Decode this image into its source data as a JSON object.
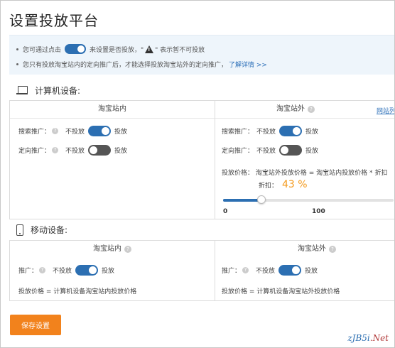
{
  "page": {
    "title": "设置投放平台"
  },
  "notice": {
    "line1_prefix": "您可通过点击",
    "line1_middle": "来设置是否投放，\"",
    "line1_suffix": "\" 表示暂不可投放",
    "line2_text": "您只有投放淘宝站内的定向推广后，才能选择投放淘宝站外的定向推广，",
    "line2_link": "了解详情 >>"
  },
  "pc": {
    "section_title": "计算机设备:",
    "left_header": "淘宝站内",
    "right_header": "淘宝站外",
    "right_link": "网站列",
    "left": {
      "search": {
        "label": "搜索推广：",
        "off": "不投放",
        "on": "投放",
        "state": "on"
      },
      "target": {
        "label": "定向推广：",
        "off": "不投放",
        "on": "投放",
        "state": "off"
      }
    },
    "right": {
      "search": {
        "label": "搜索推广：",
        "off": "不投放",
        "on": "投放",
        "state": "on"
      },
      "target": {
        "label": "定向推广：",
        "off": "不投放",
        "on": "投放",
        "state": "off"
      },
      "price_text": "投放价格：  淘宝站外投放价格 = 淘宝站内投放价格 * 折扣",
      "discount_label": "折扣：",
      "discount_value": "43 %",
      "slider": {
        "min": "0",
        "max": "100",
        "value": 43
      }
    }
  },
  "mobile": {
    "section_title": "移动设备:",
    "left_header": "淘宝站内",
    "right_header": "淘宝站外",
    "left": {
      "promo": {
        "label": "推广：",
        "off": "不投放",
        "on": "投放",
        "state": "on"
      },
      "price_text": "投放价格 =  计算机设备淘宝站内投放价格"
    },
    "right": {
      "promo": {
        "label": "推广：",
        "off": "不投放",
        "on": "投放",
        "state": "on"
      },
      "price_text": "投放价格 =  计算机设备淘宝站外投放价格"
    }
  },
  "footer": {
    "save_button": "保存设置"
  },
  "watermark": {
    "text1": "zJB5i",
    "text2": ".Net"
  },
  "colors": {
    "accent": "#2c6fb2",
    "orange": "#f39a1e",
    "button": "#f2821c"
  }
}
